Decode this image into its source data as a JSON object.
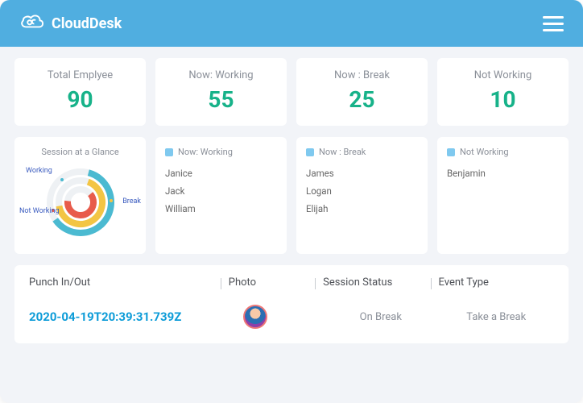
{
  "brand": {
    "name": "CloudDesk"
  },
  "stats": [
    {
      "label": "Total Emplyee",
      "value": "90"
    },
    {
      "label": "Now: Working",
      "value": "55"
    },
    {
      "label": "Now : Break",
      "value": "25"
    },
    {
      "label": "Not Working",
      "value": "10"
    }
  ],
  "glance": {
    "title": "Session at a Glance",
    "legend": {
      "working": "Working",
      "break": "Break",
      "not_working": "Not Working"
    }
  },
  "panels": {
    "working": {
      "title": "Now: Working",
      "names": [
        "Janice",
        "Jack",
        "William"
      ]
    },
    "break": {
      "title": "Now : Break",
      "names": [
        "James",
        "Logan",
        "Elijah"
      ]
    },
    "not_working": {
      "title": "Not Working",
      "names": [
        "Benjamin"
      ]
    }
  },
  "table": {
    "headers": {
      "punch": "Punch In/Out",
      "photo": "Photo",
      "status": "Session Status",
      "event": "Event Type"
    },
    "row": {
      "punch": "2020-04-19T20:39:31.739Z",
      "status": "On Break",
      "event": "Take a Break"
    }
  },
  "colors": {
    "accent": "#50aee0",
    "stat": "#17b289",
    "link": "#0d9cd8"
  },
  "chart_data": {
    "type": "pie",
    "title": "Session at a Glance",
    "series": [
      {
        "name": "Working",
        "value": 55
      },
      {
        "name": "Break",
        "value": 25
      },
      {
        "name": "Not Working",
        "value": 10
      }
    ]
  }
}
